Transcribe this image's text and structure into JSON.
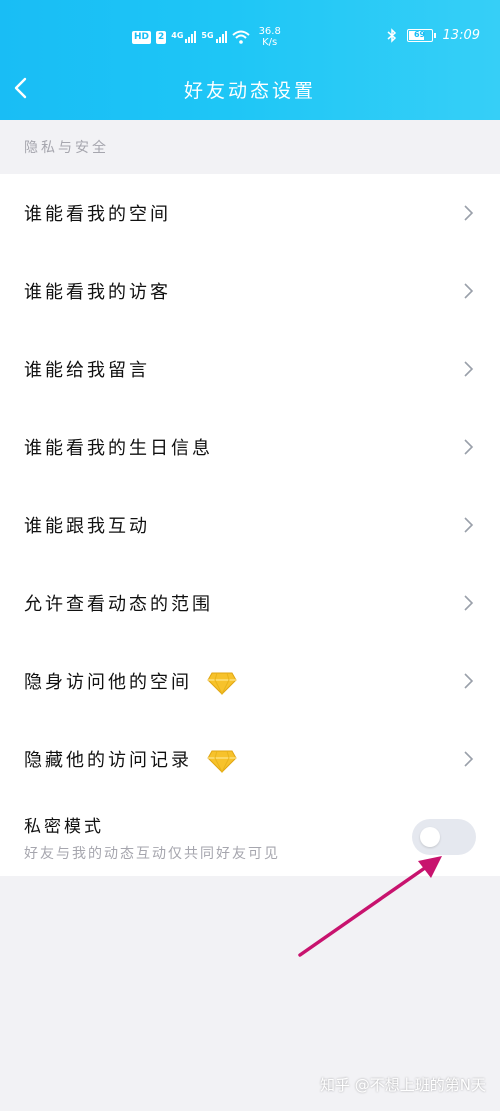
{
  "status_bar": {
    "hd_badge": "HD",
    "sim_badge": "2",
    "net1": "4G",
    "net2": "5G",
    "speed_value": "36.8",
    "speed_unit": "K/s",
    "battery": "69",
    "time": "13:09"
  },
  "nav": {
    "title": "好友动态设置"
  },
  "section": {
    "header": "隐私与安全"
  },
  "rows": [
    {
      "label": "谁能看我的空间",
      "premium": false
    },
    {
      "label": "谁能看我的访客",
      "premium": false
    },
    {
      "label": "谁能给我留言",
      "premium": false
    },
    {
      "label": "谁能看我的生日信息",
      "premium": false
    },
    {
      "label": "谁能跟我互动",
      "premium": false
    },
    {
      "label": "允许查看动态的范围",
      "premium": false
    },
    {
      "label": "隐身访问他的空间",
      "premium": true
    },
    {
      "label": "隐藏他的访问记录",
      "premium": true
    }
  ],
  "private_mode": {
    "title": "私密模式",
    "description": "好友与我的动态互动仅共同好友可见",
    "enabled": false
  },
  "watermark": "知乎 @不想上班的第N天",
  "colors": {
    "header_gradient_start": "#19bdf5",
    "header_gradient_end": "#36cff7",
    "background": "#f2f2f5",
    "arrow_annotation": "#c8136e",
    "diamond": "#f7c22b"
  }
}
